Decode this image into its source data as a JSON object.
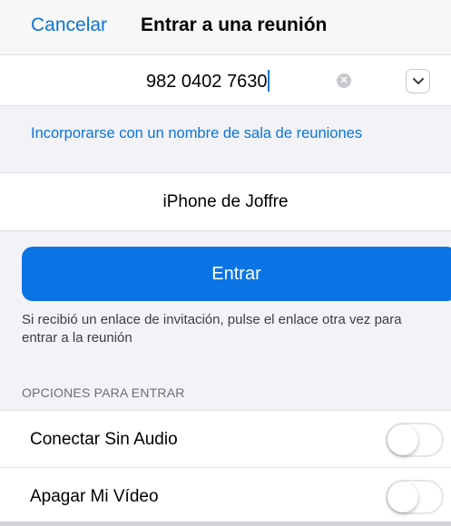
{
  "nav": {
    "cancel_label": "Cancelar",
    "title": "Entrar a una reunión"
  },
  "meeting_id": {
    "value": "982 0402 7630",
    "clear_icon": "clear-icon",
    "dropdown_icon": "chevron-down-icon"
  },
  "room_link_label": "Incorporarse con un nombre de sala de reuniones",
  "display_name": "iPhone de Joffre",
  "join_button_label": "Entrar",
  "hint_text": "Si recibió un enlace de invitación, pulse el enlace otra vez para entrar a la reunión",
  "options": {
    "header": "OPCIONES PARA ENTRAR",
    "items": [
      {
        "label": "Conectar Sin Audio",
        "enabled": false
      },
      {
        "label": "Apagar Mi Vídeo",
        "enabled": false
      }
    ]
  },
  "colors": {
    "accent": "#0a74da",
    "button": "#0b74e5",
    "background": "#f2f2f7"
  }
}
